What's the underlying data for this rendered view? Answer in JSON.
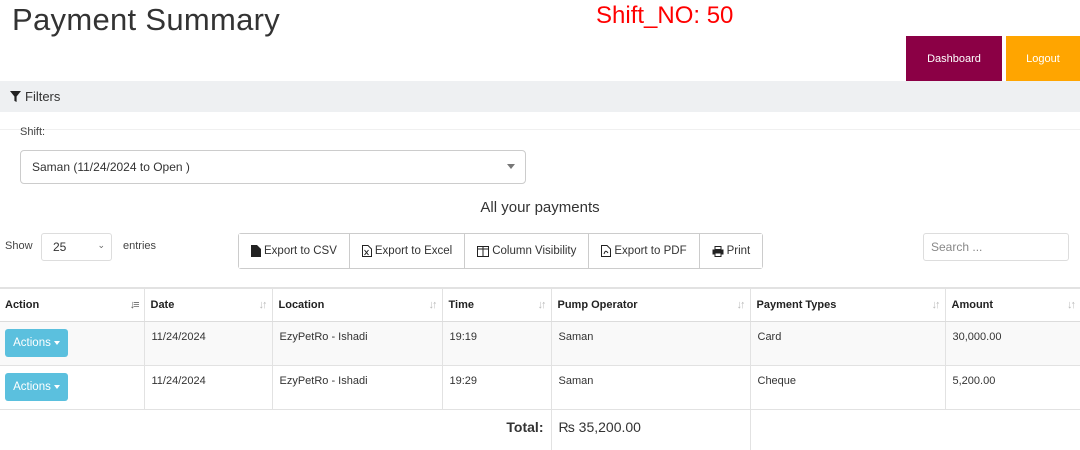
{
  "header": {
    "title": "Payment Summary",
    "shift_no": "Shift_NO: 50",
    "dashboard_label": "Dashboard",
    "logout_label": "Logout"
  },
  "filters": {
    "label": "Filters",
    "shift_label": "Shift:",
    "shift_value": "Saman (11/24/2024 to Open )"
  },
  "table": {
    "caption": "All your payments",
    "show_label": "Show",
    "entries_value": "25",
    "entries_label": "entries",
    "export_buttons": [
      "Export to CSV",
      "Export to Excel",
      "Column Visibility",
      "Export to PDF",
      "Print"
    ],
    "search_placeholder": "Search ...",
    "columns": [
      "Action",
      "Date",
      "Location",
      "Time",
      "Pump Operator",
      "Payment Types",
      "Amount"
    ],
    "rows": [
      {
        "action": "Actions",
        "date": "11/24/2024",
        "location": "EzyPetRo - Ishadi",
        "time": "19:19",
        "operator": "Saman",
        "payment_type": "Card",
        "amount": "30,000.00"
      },
      {
        "action": "Actions",
        "date": "11/24/2024",
        "location": "EzyPetRo - Ishadi",
        "time": "19:29",
        "operator": "Saman",
        "payment_type": "Cheque",
        "amount": "5,200.00"
      }
    ],
    "total_label": "Total:",
    "total_value": "₨ 35,200.00"
  },
  "colors": {
    "dashboard_bg": "#8b0045",
    "logout_bg": "#ffa500",
    "shift_no_color": "#ff0000",
    "actions_bg": "#5bc0de",
    "total_color": "#a52a2a"
  }
}
